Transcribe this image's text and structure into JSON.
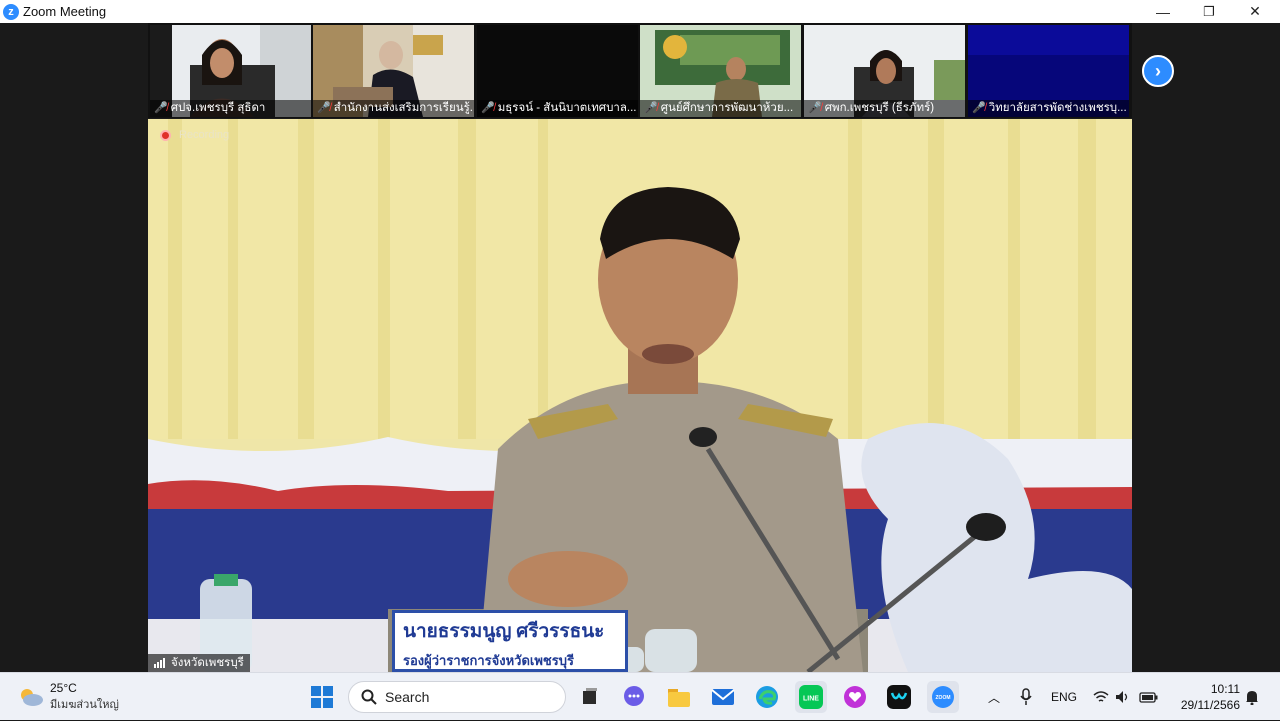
{
  "window": {
    "title": "Zoom Meeting",
    "minimize": "—",
    "maximize": "❐",
    "close": "✕"
  },
  "participants": [
    {
      "name": "ศปจ.เพชรบุรี สุธิดา"
    },
    {
      "name": "สำนักงานส่งเสริมการเรียนรู้..."
    },
    {
      "name": "มธุรจน์ - สันนิบาตเทศบาล..."
    },
    {
      "name": "ศูนย์ศึกษาการพัฒนาห้วย..."
    },
    {
      "name": "ศพก.เพชรบุรี (ธีรภัทร์)"
    },
    {
      "name": "วิทยาลัยสารพัดช่างเพชรบุ..."
    }
  ],
  "main": {
    "recording_label": "Recording",
    "speaker_name": "จังหวัดเพชรบุรี",
    "nameplate_name": "นายธรรมนูญ ศรีวรรธนะ",
    "nameplate_title": "รองผู้ว่าราชการจังหวัดเพชรบุรี"
  },
  "taskbar": {
    "weather_temp": "25°C",
    "weather_desc": "มีเมฆส่วนใหญ่",
    "search_label": "Search",
    "language": "ENG",
    "time": "10:11",
    "date": "29/11/2566"
  },
  "colors": {
    "zoom_blue": "#2d8cff",
    "line_green": "#06c755",
    "taskbar_bg": "#eef1f7"
  }
}
